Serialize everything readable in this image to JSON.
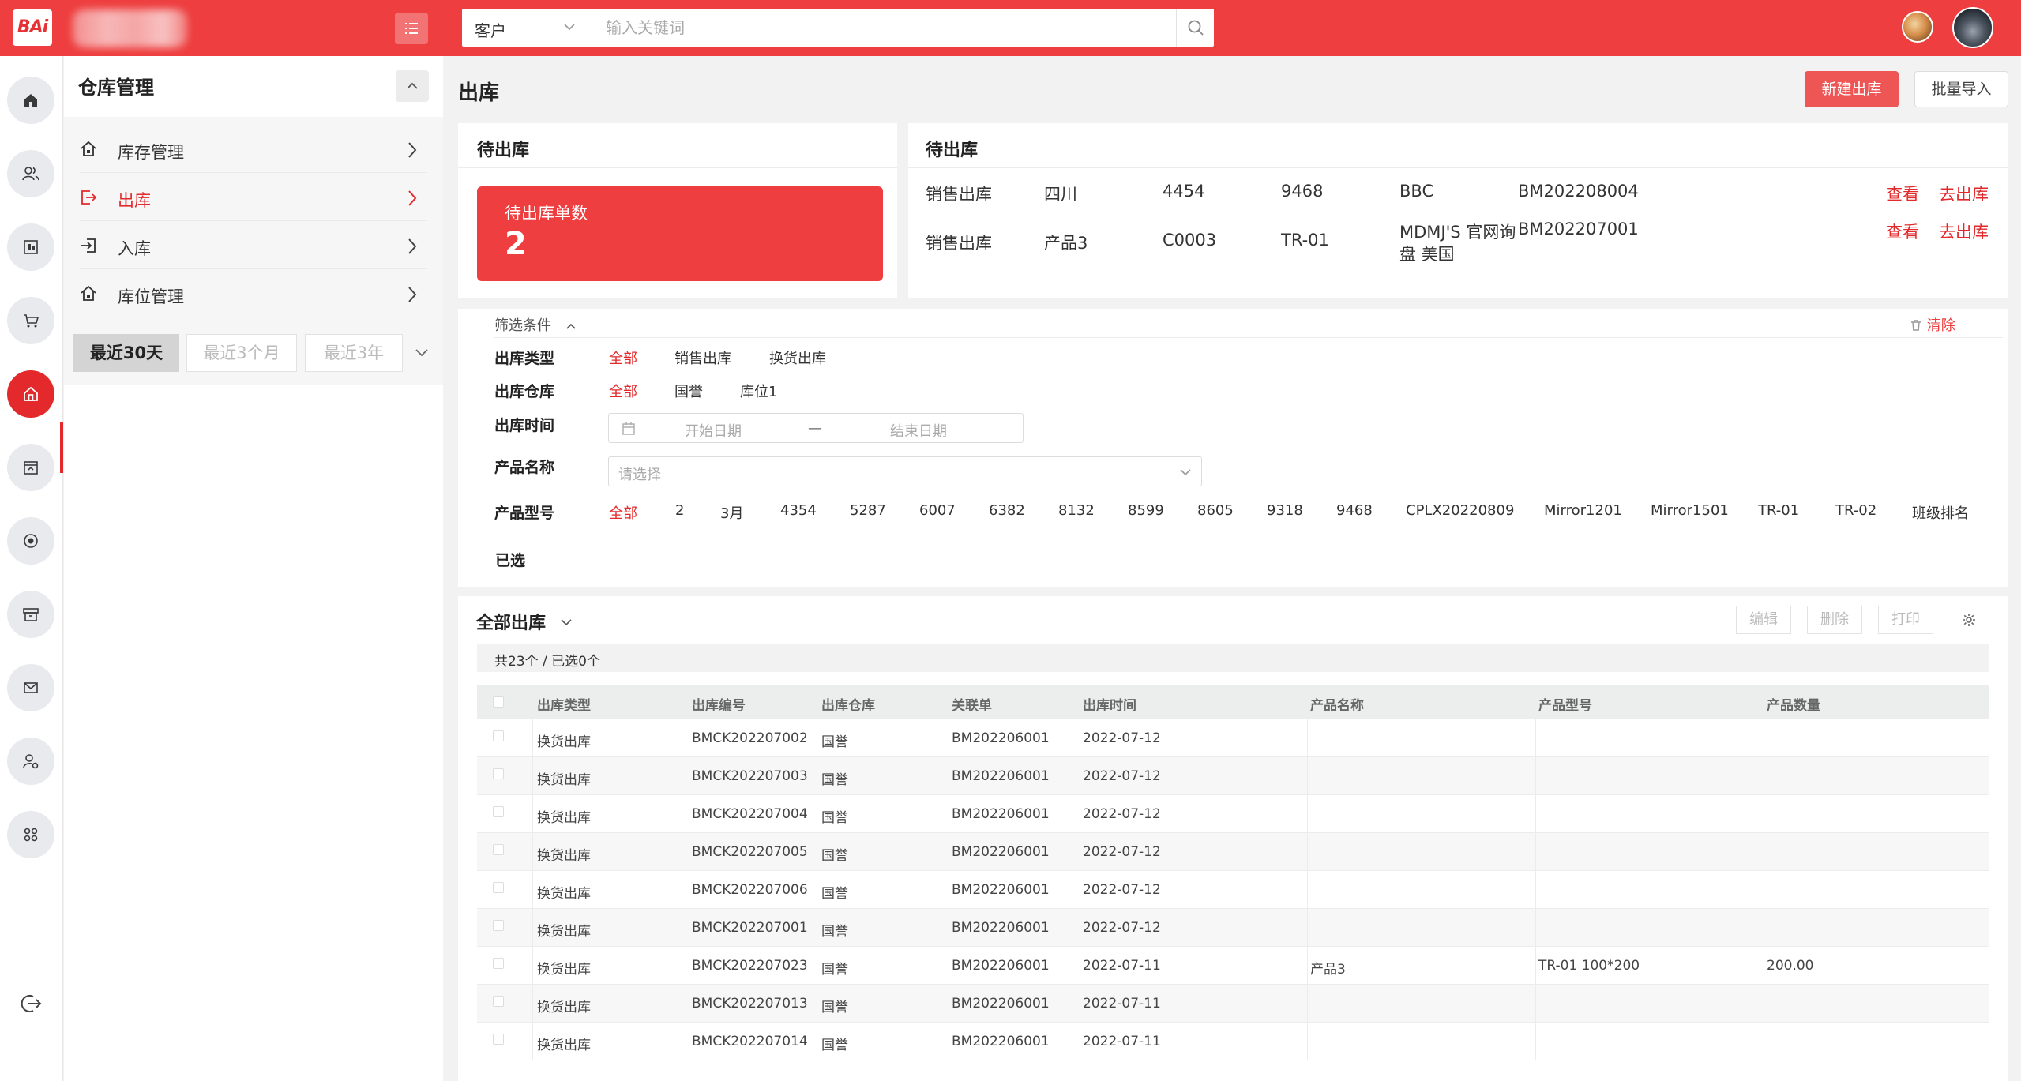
{
  "topbar": {
    "logo_text": "BAi",
    "search": {
      "type_selected": "客户",
      "placeholder": "输入关键词"
    }
  },
  "rail": {
    "icons": [
      "home-icon",
      "users-icon",
      "report-icon",
      "cart-icon",
      "warehouse-icon",
      "archive-upload-icon",
      "coin-icon",
      "box-icon",
      "mail-icon",
      "user-settings-icon",
      "apps-icon"
    ],
    "active_index": 4,
    "logout_icon": "logout-icon"
  },
  "subnav": {
    "title": "仓库管理",
    "items": [
      {
        "label": "库存管理",
        "icon": "house-icon",
        "active": false
      },
      {
        "label": "出库",
        "icon": "export-icon",
        "active": true
      },
      {
        "label": "入库",
        "icon": "import-icon",
        "active": false
      },
      {
        "label": "库位管理",
        "icon": "house-icon",
        "active": false
      }
    ],
    "ranges": [
      "最近30天",
      "最近3个月",
      "最近3年"
    ],
    "range_active": 0
  },
  "page": {
    "title": "出库",
    "btn_new": "新建出库",
    "btn_import": "批量导入"
  },
  "pending_left": {
    "title": "待出库",
    "count_label": "待出库单数",
    "count_value": "2"
  },
  "pending_right": {
    "title": "待出库",
    "view_label": "查看",
    "go_label": "去出库",
    "rows": [
      {
        "type": "销售出库",
        "c1": "四川",
        "c2": "4454",
        "c3": "9468",
        "c4": "BBC",
        "c4b": "",
        "order": "BM202208004"
      },
      {
        "type": "销售出库",
        "c1": "产品3",
        "c2": "C0003",
        "c3": "TR-01",
        "c4": "MDMJ'S 官网询",
        "c4b": "盘 美国",
        "order": "BM202207001"
      }
    ]
  },
  "filters": {
    "header": "筛选条件",
    "clear": "清除",
    "type_label": "出库类型",
    "type_options": [
      "全部",
      "销售出库",
      "换货出库"
    ],
    "warehouse_label": "出库仓库",
    "warehouse_options": [
      "全部",
      "国誉",
      "库位1"
    ],
    "time_label": "出库时间",
    "date_start": "开始日期",
    "date_sep": "—",
    "date_end": "结束日期",
    "product_label": "产品名称",
    "product_placeholder": "请选择",
    "model_label": "产品型号",
    "model_options": [
      "全部",
      "2",
      "3月",
      "4354",
      "5287",
      "6007",
      "6382",
      "8132",
      "8599",
      "8605",
      "9318",
      "9468",
      "CPLX20220809",
      "Mirror1201",
      "Mirror1501",
      "TR-01",
      "TR-02",
      "班级排名"
    ],
    "selected_label": "已选"
  },
  "table": {
    "title": "全部出库",
    "btn_edit": "编辑",
    "btn_delete": "删除",
    "btn_print": "打印",
    "summary": "共23个 / 已选0个",
    "columns": [
      "出库类型",
      "出库编号",
      "出库仓库",
      "关联单",
      "出库时间",
      "产品名称",
      "产品型号",
      "产品数量"
    ],
    "rows": [
      [
        "换货出库",
        "BMCK202207002",
        "国誉",
        "BM202206001",
        "2022-07-12",
        "",
        "",
        ""
      ],
      [
        "换货出库",
        "BMCK202207003",
        "国誉",
        "BM202206001",
        "2022-07-12",
        "",
        "",
        ""
      ],
      [
        "换货出库",
        "BMCK202207004",
        "国誉",
        "BM202206001",
        "2022-07-12",
        "",
        "",
        ""
      ],
      [
        "换货出库",
        "BMCK202207005",
        "国誉",
        "BM202206001",
        "2022-07-12",
        "",
        "",
        ""
      ],
      [
        "换货出库",
        "BMCK202207006",
        "国誉",
        "BM202206001",
        "2022-07-12",
        "",
        "",
        ""
      ],
      [
        "换货出库",
        "BMCK202207001",
        "国誉",
        "BM202206001",
        "2022-07-12",
        "",
        "",
        ""
      ],
      [
        "换货出库",
        "BMCK202207023",
        "国誉",
        "BM202206001",
        "2022-07-11",
        "产品3",
        "TR-01 100*200",
        "200.00"
      ],
      [
        "换货出库",
        "BMCK202207013",
        "国誉",
        "BM202206001",
        "2022-07-11",
        "",
        "",
        ""
      ],
      [
        "换货出库",
        "BMCK202207014",
        "国誉",
        "BM202206001",
        "2022-07-11",
        "",
        "",
        ""
      ]
    ]
  },
  "colors": {
    "accent": "#ee3e3f",
    "active_red": "#e3292b"
  }
}
